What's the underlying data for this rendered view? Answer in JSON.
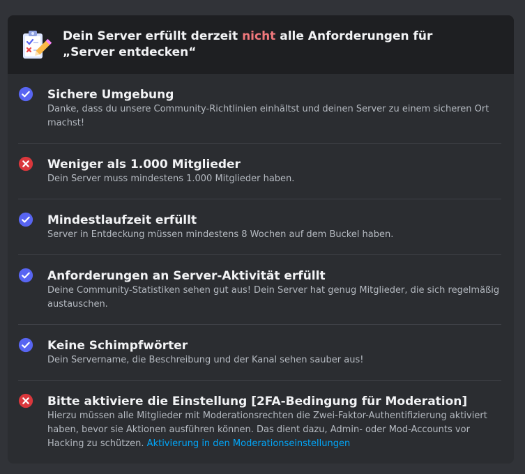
{
  "header": {
    "title_before": "Dein Server erfüllt derzeit ",
    "title_highlight": "nicht",
    "title_after": " alle Anforderungen für „Server entdecken“"
  },
  "colors": {
    "pass": "#5865f2",
    "fail": "#da373c",
    "highlight": "#f0787c",
    "link": "#00a8fc"
  },
  "requirements": [
    {
      "status": "pass",
      "icon": "check-circle-icon",
      "title": "Sichere Umgebung",
      "description": "Danke, dass du unsere Community-Richtlinien einhältst und deinen Server zu einem sicheren Ort machst!"
    },
    {
      "status": "fail",
      "icon": "x-circle-icon",
      "title": "Weniger als 1.000 Mitglieder",
      "description": "Dein Server muss mindestens 1.000 Mitglieder haben."
    },
    {
      "status": "pass",
      "icon": "check-circle-icon",
      "title": "Mindestlaufzeit erfüllt",
      "description": "Server in Entdeckung müssen mindestens 8 Wochen auf dem Buckel haben."
    },
    {
      "status": "pass",
      "icon": "check-circle-icon",
      "title": "Anforderungen an Server-Aktivität erfüllt",
      "description": "Deine Community-Statistiken sehen gut aus! Dein Server hat genug Mitglieder, die sich regelmäßig austauschen."
    },
    {
      "status": "pass",
      "icon": "check-circle-icon",
      "title": "Keine Schimpfwörter",
      "description": "Dein Servername, die Beschreibung und der Kanal sehen sauber aus!"
    },
    {
      "status": "fail",
      "icon": "x-circle-icon",
      "title": "Bitte aktiviere die Einstellung [2FA-Bedingung für Moderation]",
      "description": "Hierzu müssen alle Mitglieder mit Moderationsrechten die Zwei-Faktor-Authentifizierung aktiviert haben, bevor sie Aktionen ausführen können. Das dient dazu, Admin- oder Mod-Accounts vor Hacking zu schützen. ",
      "link": "Aktivierung in den Moderationseinstellungen"
    }
  ]
}
